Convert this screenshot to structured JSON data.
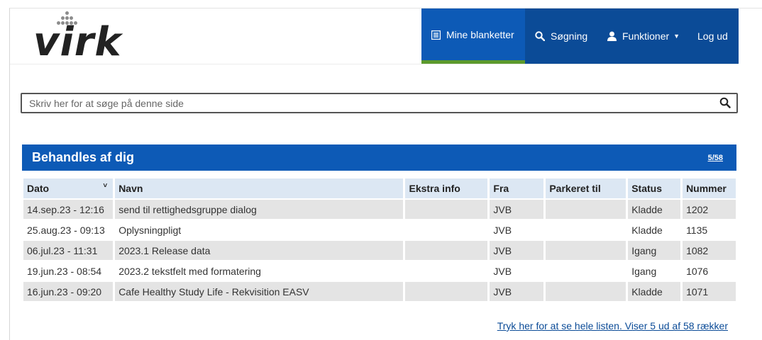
{
  "logo": {
    "text": "virk"
  },
  "nav": {
    "items": [
      {
        "label": "Mine blanketter",
        "icon": "document-list-icon",
        "active": true
      },
      {
        "label": "Søgning",
        "icon": "search-icon"
      },
      {
        "label": "Funktioner",
        "icon": "user-icon",
        "has_dropdown": true
      },
      {
        "label": "Log ud"
      }
    ]
  },
  "search": {
    "placeholder": "Skriv her for at søge på denne side",
    "value": ""
  },
  "panel": {
    "title": "Behandles af dig",
    "count_link": "5/58"
  },
  "table": {
    "columns": [
      "Dato",
      "Navn",
      "Ekstra info",
      "Fra",
      "Parkeret til",
      "Status",
      "Nummer"
    ],
    "rows": [
      {
        "dato": "14.sep.23 - 12:16",
        "navn": "send til rettighedsgruppe dialog",
        "ekstra": "",
        "fra": "JVB",
        "parkeret": "",
        "status": "Kladde",
        "nummer": "1202"
      },
      {
        "dato": "25.aug.23 - 09:13",
        "navn": "Oplysningpligt",
        "ekstra": "",
        "fra": "JVB",
        "parkeret": "",
        "status": "Kladde",
        "nummer": "1135"
      },
      {
        "dato": "06.jul.23 - 11:31",
        "navn": "2023.1 Release data",
        "ekstra": "",
        "fra": "JVB",
        "parkeret": "",
        "status": "Igang",
        "nummer": "1082"
      },
      {
        "dato": "19.jun.23 - 08:54",
        "navn": "2023.2 tekstfelt med formatering",
        "ekstra": "",
        "fra": "JVB",
        "parkeret": "",
        "status": "Igang",
        "nummer": "1076"
      },
      {
        "dato": "16.jun.23 - 09:20",
        "navn": "Cafe Healthy Study Life - Rekvisition EASV",
        "ekstra": "",
        "fra": "JVB",
        "parkeret": "",
        "status": "Kladde",
        "nummer": "1071"
      }
    ]
  },
  "footer": {
    "link": "Tryk her for at se hele listen. Viser 5 ud af 58 rækker"
  },
  "colors": {
    "nav_bg": "#0b4b97",
    "nav_active": "#0d5ab6",
    "active_bar": "#5c9a2c",
    "header_row": "#dce7f3",
    "row_shade": "#e4e4e4"
  }
}
